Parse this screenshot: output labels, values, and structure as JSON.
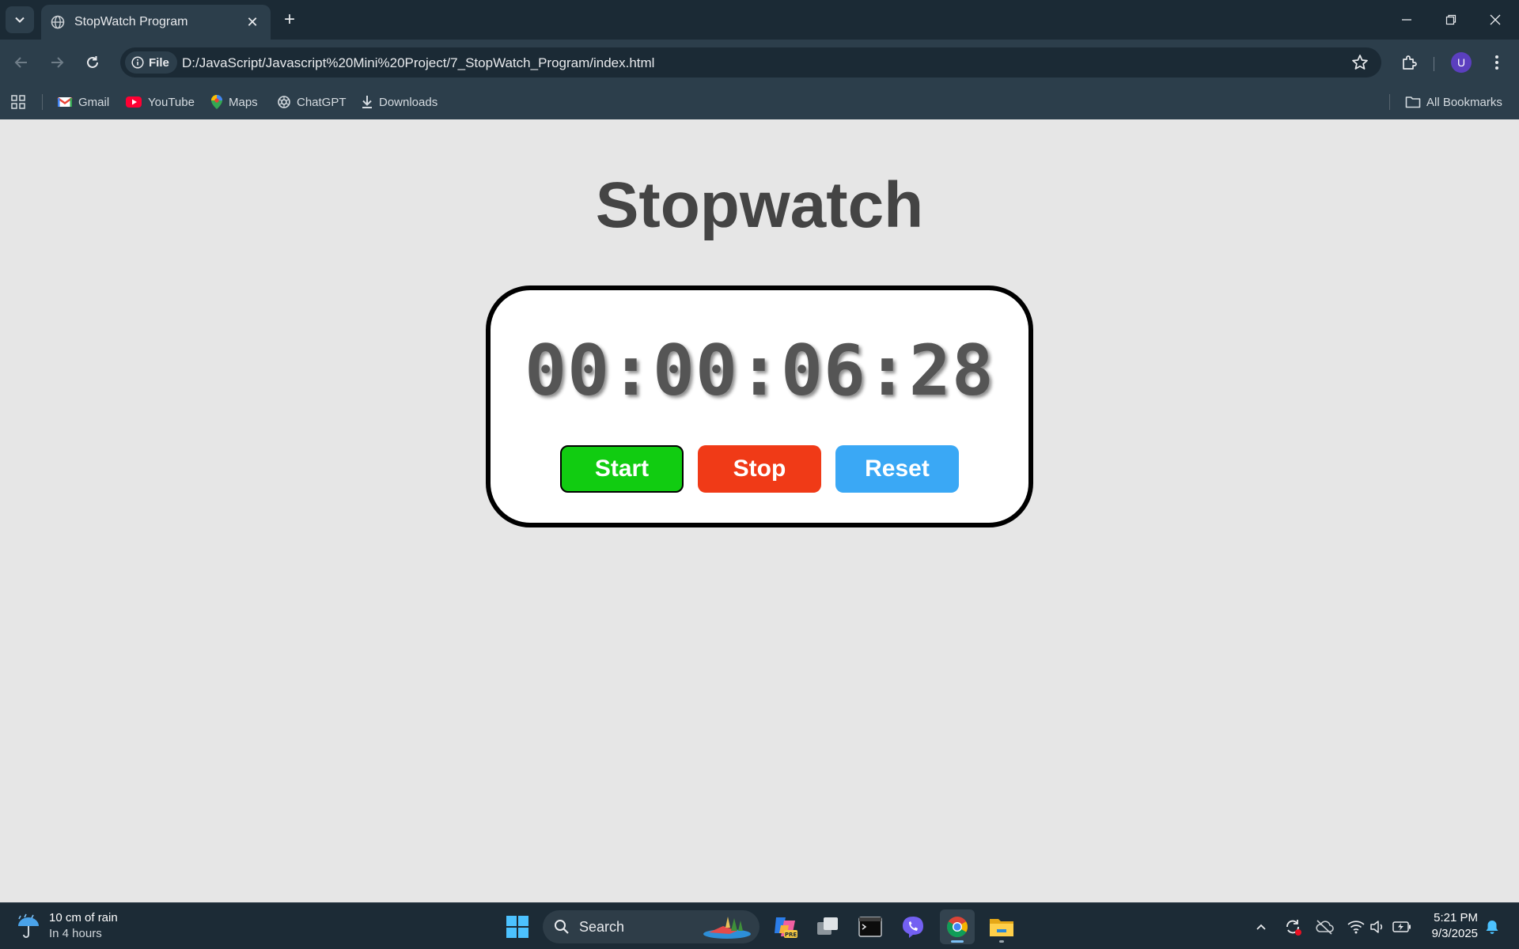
{
  "browser": {
    "tab_title": "StopWatch Program",
    "tab_close": "✕",
    "new_tab": "+",
    "file_chip": "File",
    "url": "D:/JavaScript/Javascript%20Mini%20Project/7_StopWatch_Program/index.html",
    "avatar_letter": "U"
  },
  "bookmarks": {
    "items": [
      {
        "label": "Gmail",
        "icon": "gmail-icon"
      },
      {
        "label": "YouTube",
        "icon": "youtube-icon"
      },
      {
        "label": "Maps",
        "icon": "maps-icon"
      },
      {
        "label": "ChatGPT",
        "icon": "chatgpt-icon"
      },
      {
        "label": "Downloads",
        "icon": "download-icon"
      }
    ],
    "all_bookmarks": "All Bookmarks"
  },
  "page": {
    "heading": "Stopwatch",
    "display": "00:00:06:28",
    "buttons": {
      "start": "Start",
      "stop": "Stop",
      "reset": "Reset"
    }
  },
  "colors": {
    "start": "#11cc11",
    "stop": "#f03a17",
    "reset": "#3aa8f5",
    "page_background": "#e6e6e6",
    "browser_chrome": "#2c3e4b"
  },
  "taskbar": {
    "weather_title": "10 cm of rain",
    "weather_sub": "In 4 hours",
    "search_label": "Search",
    "time": "5:21 PM",
    "date": "9/3/2025"
  }
}
